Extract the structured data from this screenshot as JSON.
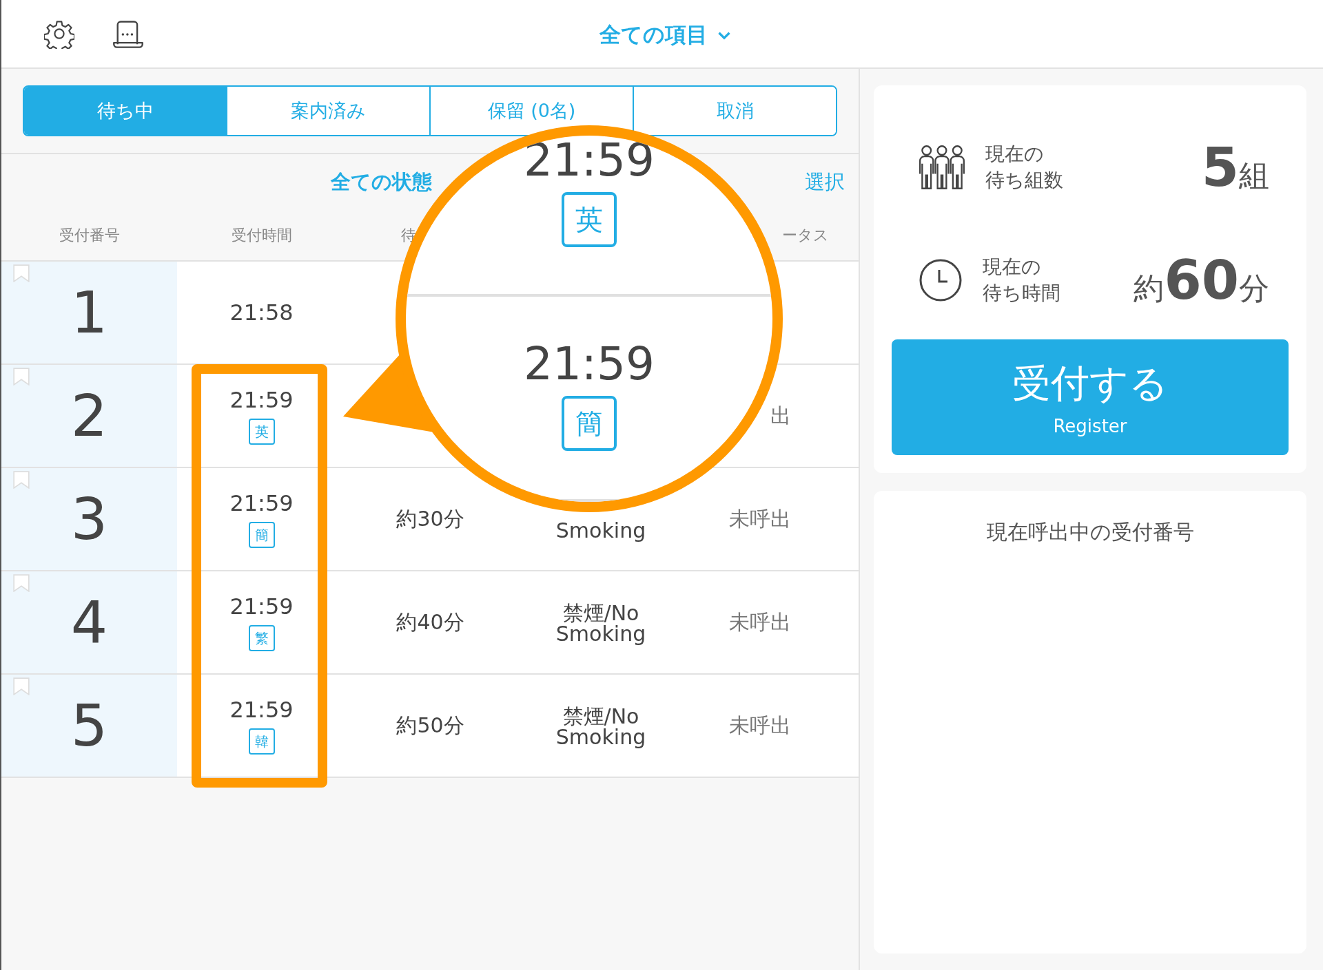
{
  "top_bar": {
    "title": "全ての項目"
  },
  "tabs": [
    {
      "label": "待ち中",
      "selected": true
    },
    {
      "label": "案内済み",
      "selected": false
    },
    {
      "label": "保留 (0名)",
      "selected": false
    },
    {
      "label": "取消",
      "selected": false
    }
  ],
  "filter": {
    "label": "全ての状態",
    "action": "選択"
  },
  "table": {
    "columns": [
      "受付番号",
      "受付時間",
      "待",
      null,
      "ータス"
    ],
    "rows": [
      {
        "number": "1",
        "time": "21:58"
      },
      {
        "number": "2",
        "time": "21:59",
        "language": "英",
        "status": "出"
      },
      {
        "number": "3",
        "time": "21:59",
        "language": "簡",
        "wait": "約30分",
        "seat": "Smoking",
        "status": "未呼出"
      },
      {
        "number": "4",
        "time": "21:59",
        "language": "繁",
        "wait": "約40分",
        "seat": "禁煙/No Smoking",
        "status": "未呼出"
      },
      {
        "number": "5",
        "time": "21:59",
        "language": "韓",
        "wait": "約50分",
        "seat": "禁煙/No Smoking",
        "status": "未呼出"
      }
    ]
  },
  "magnifier": {
    "rows": [
      {
        "time": "21:59",
        "language": "英"
      },
      {
        "time": "21:59",
        "language": "簡"
      }
    ]
  },
  "stats": [
    {
      "kind": "groups",
      "label": [
        "現在の",
        "待ち組数"
      ],
      "value": "5",
      "unit": "組"
    },
    {
      "kind": "time",
      "label": [
        "現在の",
        "待ち時間"
      ],
      "prefix": "約",
      "value": "60",
      "unit": "分"
    }
  ],
  "register_button": {
    "label": "受付する",
    "sublabel": "Register"
  },
  "calling_panel": {
    "title": "現在呼出中の受付番号"
  }
}
